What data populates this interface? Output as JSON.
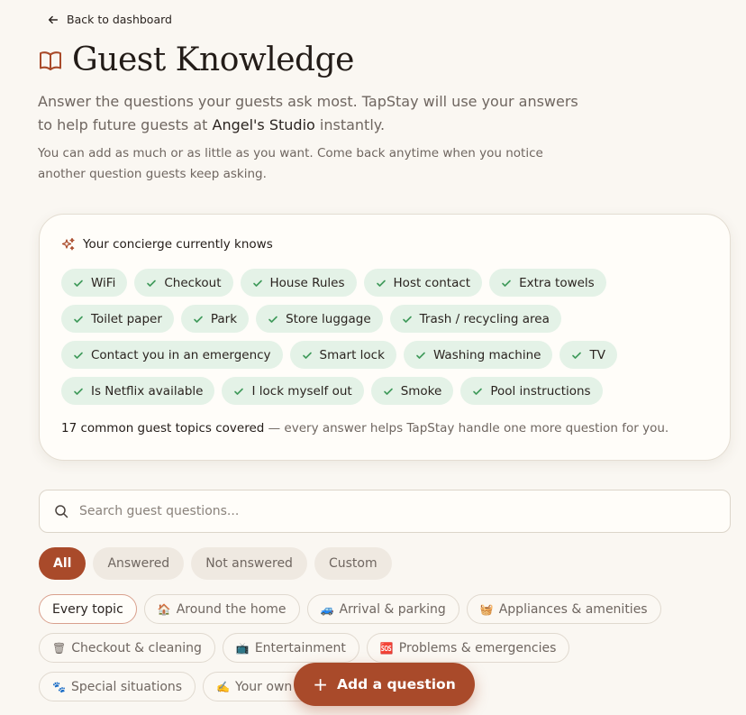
{
  "nav": {
    "back_label": "Back to dashboard"
  },
  "header": {
    "title": "Guest Knowledge",
    "intro_before": "Answer the questions your guests ask most. TapStay will use your answers to help future guests at ",
    "property_name": "Angel's Studio",
    "intro_after": " instantly.",
    "note": "You can add as much or as little as you want. Come back anytime when you notice another question guests keep asking."
  },
  "concierge": {
    "heading": "Your concierge currently knows",
    "topics": [
      "WiFi",
      "Checkout",
      "House Rules",
      "Host contact",
      "Extra towels",
      "Toilet paper",
      "Park",
      "Store luggage",
      "Trash / recycling area",
      "Contact you in an emergency",
      "Smart lock",
      "Washing machine",
      "TV",
      "Is Netflix available",
      "I lock myself out",
      "Smoke",
      "Pool instructions"
    ],
    "count_text": "17 common guest topics covered",
    "summary_rest": " — every answer helps TapStay handle one more question for you."
  },
  "search": {
    "placeholder": "Search guest questions..."
  },
  "filters": [
    "All",
    "Answered",
    "Not answered",
    "Custom"
  ],
  "categories": [
    {
      "emoji": "",
      "label": "Every topic"
    },
    {
      "emoji": "🏠",
      "label": "Around the home"
    },
    {
      "emoji": "🚙",
      "label": "Arrival & parking"
    },
    {
      "emoji": "🧺",
      "label": "Appliances & amenities"
    },
    {
      "emoji": "🗑",
      "label": "Checkout & cleaning"
    },
    {
      "emoji": "📺",
      "label": "Entertainment"
    },
    {
      "emoji": "🆘",
      "label": "Problems & emergencies"
    },
    {
      "emoji": "🐾",
      "label": "Special situations"
    },
    {
      "emoji": "✍️",
      "label": "Your own questions"
    }
  ],
  "actions": {
    "add_label": "Add a question"
  },
  "colors": {
    "accent": "#a94a2a",
    "chip_green": "#e4f2e7",
    "check_green": "#3f9a5a",
    "background": "#faf7f2"
  }
}
